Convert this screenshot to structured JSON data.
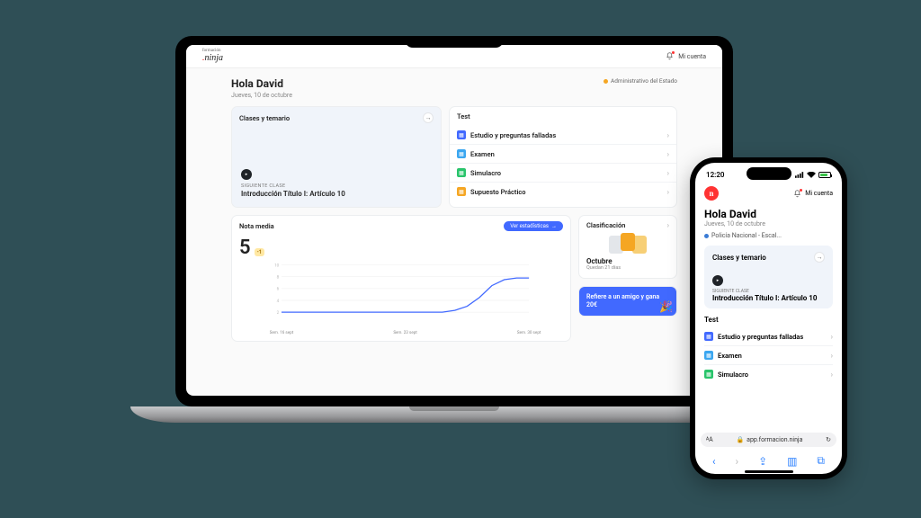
{
  "brand": {
    "name": ".ninja",
    "super": "formación"
  },
  "account_label": "Mi cuenta",
  "laptop": {
    "greeting": "Hola David",
    "date": "Jueves, 10 de octubre",
    "course": "Administrativo del Estado",
    "clases": {
      "title": "Clases y temario",
      "next_label": "SIGUIENTE CLASE",
      "next_title": "Introducción Título I: Artículo 10"
    },
    "test": {
      "title": "Test",
      "items": [
        {
          "name": "Estudio y preguntas falladas",
          "icon": "ic-blue"
        },
        {
          "name": "Examen",
          "icon": "ic-bluel"
        },
        {
          "name": "Simulacro",
          "icon": "ic-green"
        },
        {
          "name": "Supuesto Práctico",
          "icon": "ic-orange"
        }
      ]
    },
    "nota": {
      "title": "Nota media",
      "value": "5",
      "delta": "-1",
      "stats_btn": "Ver estadísticas"
    },
    "clasif": {
      "title": "Clasificación",
      "month": "Octubre",
      "sub": "Quedan 21 días"
    },
    "refer": "Refiere a un amigo y gana 20€"
  },
  "phone": {
    "time": "12:20",
    "greeting": "Hola David",
    "date": "Jueves, 10 de octubre",
    "course": "Policía Nacional - Escal...",
    "clases": {
      "title": "Clases y temario",
      "next_label": "SIGUIENTE CLASE",
      "next_title": "Introducción Título I: Artículo 10"
    },
    "test": {
      "title": "Test",
      "items": [
        {
          "name": "Estudio y preguntas falladas",
          "icon": "ic-blue"
        },
        {
          "name": "Examen",
          "icon": "ic-bluel"
        },
        {
          "name": "Simulacro",
          "icon": "ic-green"
        }
      ]
    },
    "url": "app.formacion.ninja"
  },
  "chart_data": {
    "type": "line",
    "title": "Nota media",
    "ylabel": "",
    "xlabel": "",
    "ylim": [
      0,
      10
    ],
    "y_ticks": [
      2,
      4,
      6,
      8,
      10
    ],
    "categories": [
      "Sem. 16 sept",
      "Sem. 23 sept",
      "Sem. 30 sept"
    ],
    "values": [
      2,
      2,
      2,
      2,
      2,
      2,
      2,
      2,
      2,
      2,
      2,
      2,
      2,
      2,
      2.3,
      3,
      4.5,
      6.5,
      7.5,
      7.8,
      7.8
    ]
  }
}
